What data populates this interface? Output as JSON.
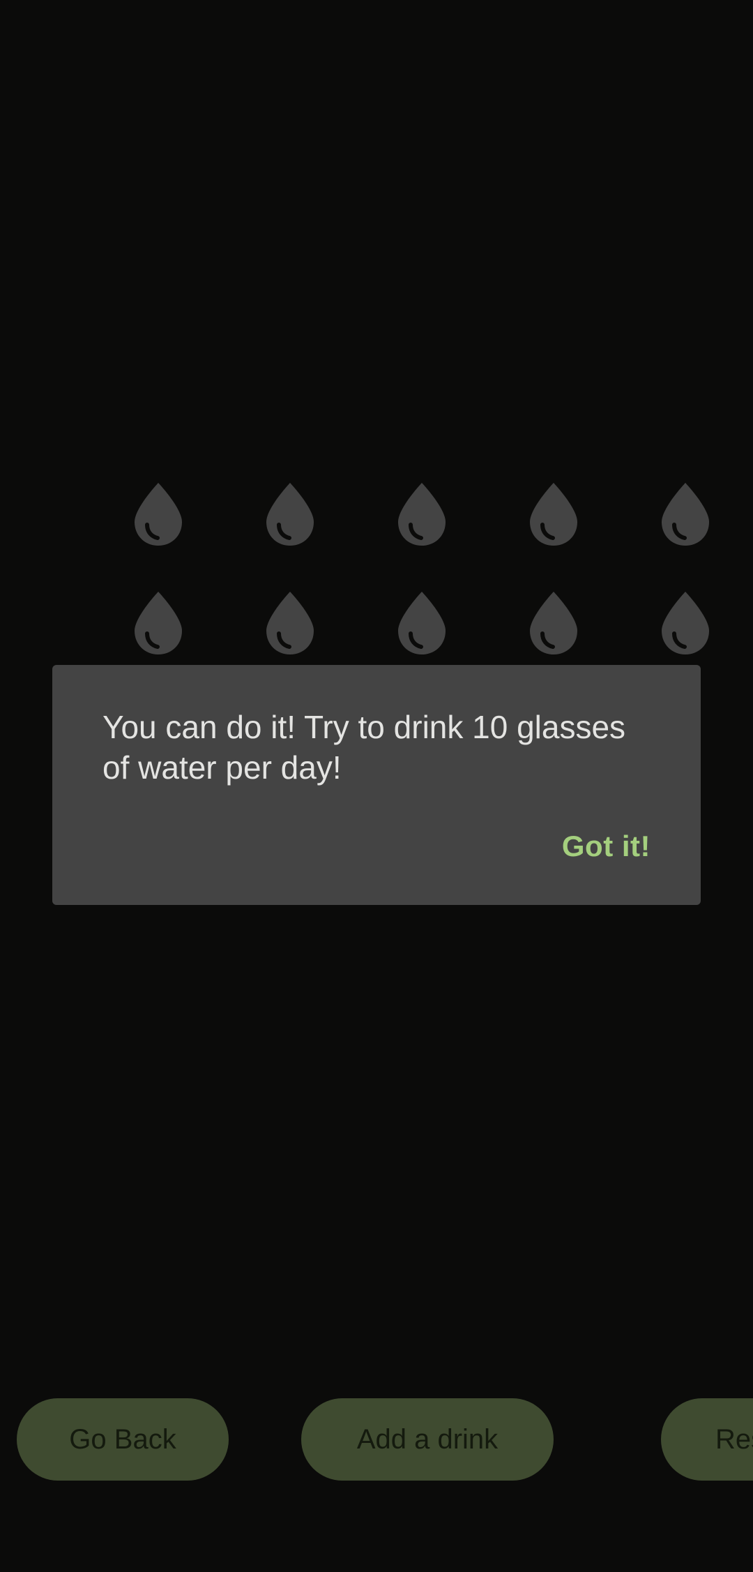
{
  "goal": {
    "glasses_total": 10,
    "glasses_drunk": 0,
    "drop_icon": "water-drop-icon",
    "drop_color": "#444444"
  },
  "dialog": {
    "message": "You can do it! Try to drink 10 glasses of water per day!",
    "action_label": "Got it!",
    "background": "#444444",
    "action_color": "#a4cf7e"
  },
  "actions": {
    "go_back_label": "Go Back",
    "add_drink_label": "Add a drink",
    "reset_label": "Res"
  },
  "colors": {
    "background": "#0b0b0a",
    "button": "#3f4b30",
    "button_text": "#141a0e"
  }
}
